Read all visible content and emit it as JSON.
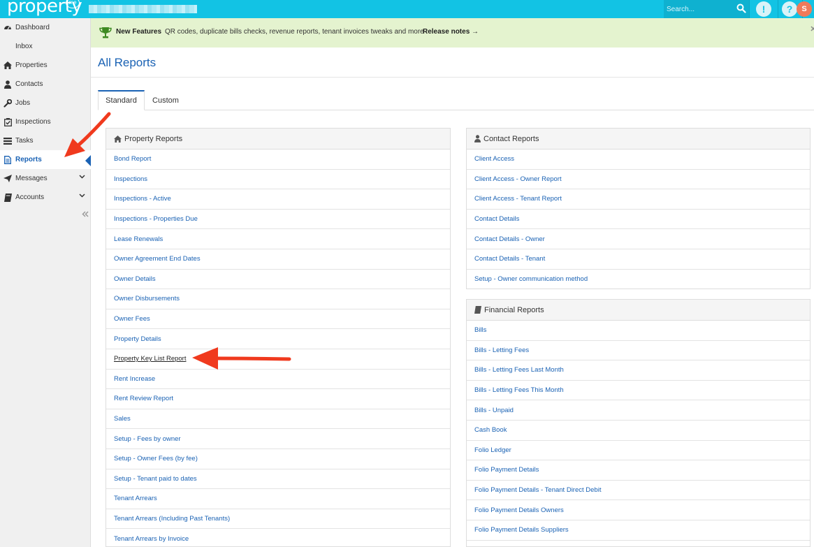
{
  "topbar": {
    "logo": "property",
    "logo_badge": "me",
    "search_placeholder": "Search...",
    "alert_icon_text": "!",
    "help_icon_text": "?",
    "avatar_text": "S"
  },
  "sidebar": {
    "items": [
      {
        "label": "Dashboard",
        "icon": "dashboard-icon"
      },
      {
        "label": "Inbox",
        "icon": "inbox-icon"
      },
      {
        "label": "Properties",
        "icon": "home-icon"
      },
      {
        "label": "Contacts",
        "icon": "user-icon"
      },
      {
        "label": "Jobs",
        "icon": "wrench-icon"
      },
      {
        "label": "Inspections",
        "icon": "checkbox-icon"
      },
      {
        "label": "Tasks",
        "icon": "list-icon"
      },
      {
        "label": "Reports",
        "icon": "document-icon",
        "active": true
      },
      {
        "label": "Messages",
        "icon": "send-icon",
        "expandable": true
      },
      {
        "label": "Accounts",
        "icon": "book-icon",
        "expandable": true
      }
    ]
  },
  "banner": {
    "title": "New Features",
    "text": "QR codes, duplicate bills checks, revenue reports, tenant invoices tweaks and more",
    "link": "Release notes →"
  },
  "page": {
    "title": "All Reports",
    "tabs": [
      {
        "label": "Standard",
        "active": true
      },
      {
        "label": "Custom",
        "active": false
      }
    ]
  },
  "property_reports": {
    "title": "Property Reports",
    "items": [
      "Bond Report",
      "Inspections",
      "Inspections - Active",
      "Inspections - Properties Due",
      "Lease Renewals",
      "Owner Agreement End Dates",
      "Owner Details",
      "Owner Disbursements",
      "Owner Fees",
      "Property Details",
      "Property Key List Report",
      "Rent Increase",
      "Rent Review Report",
      "Sales",
      "Setup - Fees by owner",
      "Setup - Owner Fees (by fee)",
      "Setup - Tenant paid to dates",
      "Tenant Arrears",
      "Tenant Arrears (Including Past Tenants)",
      "Tenant Arrears by Invoice"
    ]
  },
  "contact_reports": {
    "title": "Contact Reports",
    "items": [
      "Client Access",
      "Client Access - Owner Report",
      "Client Access - Tenant Report",
      "Contact Details",
      "Contact Details - Owner",
      "Contact Details - Tenant",
      "Setup - Owner communication method"
    ]
  },
  "financial_reports": {
    "title": "Financial Reports",
    "items": [
      "Bills",
      "Bills - Letting Fees",
      "Bills - Letting Fees Last Month",
      "Bills - Letting Fees This Month",
      "Bills - Unpaid",
      "Cash Book",
      "Folio Ledger",
      "Folio Payment Details",
      "Folio Payment Details - Tenant Direct Debit",
      "Folio Payment Details Owners",
      "Folio Payment Details Suppliers"
    ]
  },
  "colors": {
    "topbar": "#12c3e4",
    "link": "#1a62b4",
    "banner": "#e4f3cf",
    "annotation_arrow": "#f03a1e"
  }
}
